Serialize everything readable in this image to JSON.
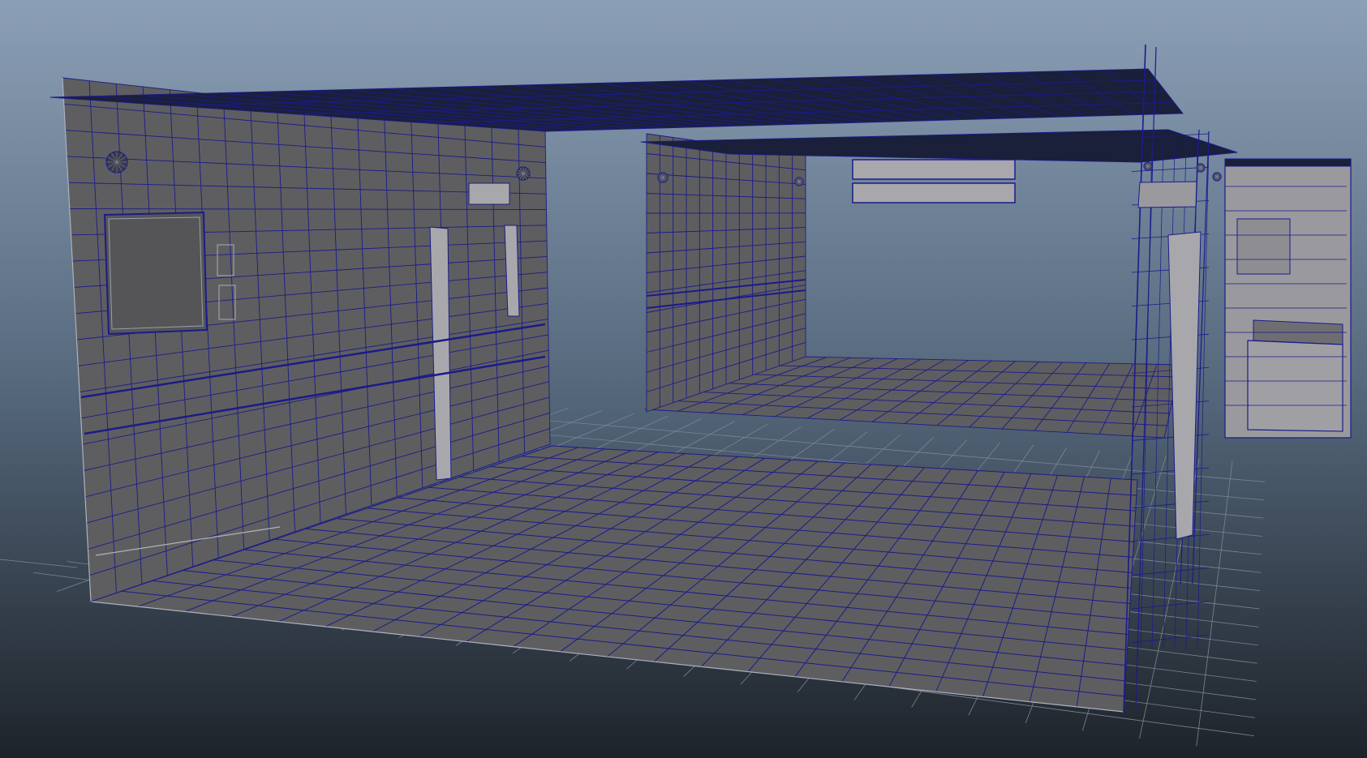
{
  "viewport": {
    "background_top": "#8b9fb6",
    "background_mid": "#56697d",
    "background_bottom": "#1e232a"
  },
  "colors": {
    "shaded_surface": "#5e5e60",
    "shaded_surface_dark": "#545456",
    "light_trim": "#a8a8ac",
    "ceiling": "#1a1f3a",
    "wireframe": "#1b1b8a",
    "ground_grid": "#7a8694"
  },
  "scene": {
    "objects": [
      "ground-grid",
      "main-floor",
      "left-wall",
      "ceiling-slab",
      "back-room-wall",
      "back-room-floor",
      "right-glass-partition",
      "counter-block",
      "ceiling-light-panels",
      "wall-clocks"
    ]
  }
}
